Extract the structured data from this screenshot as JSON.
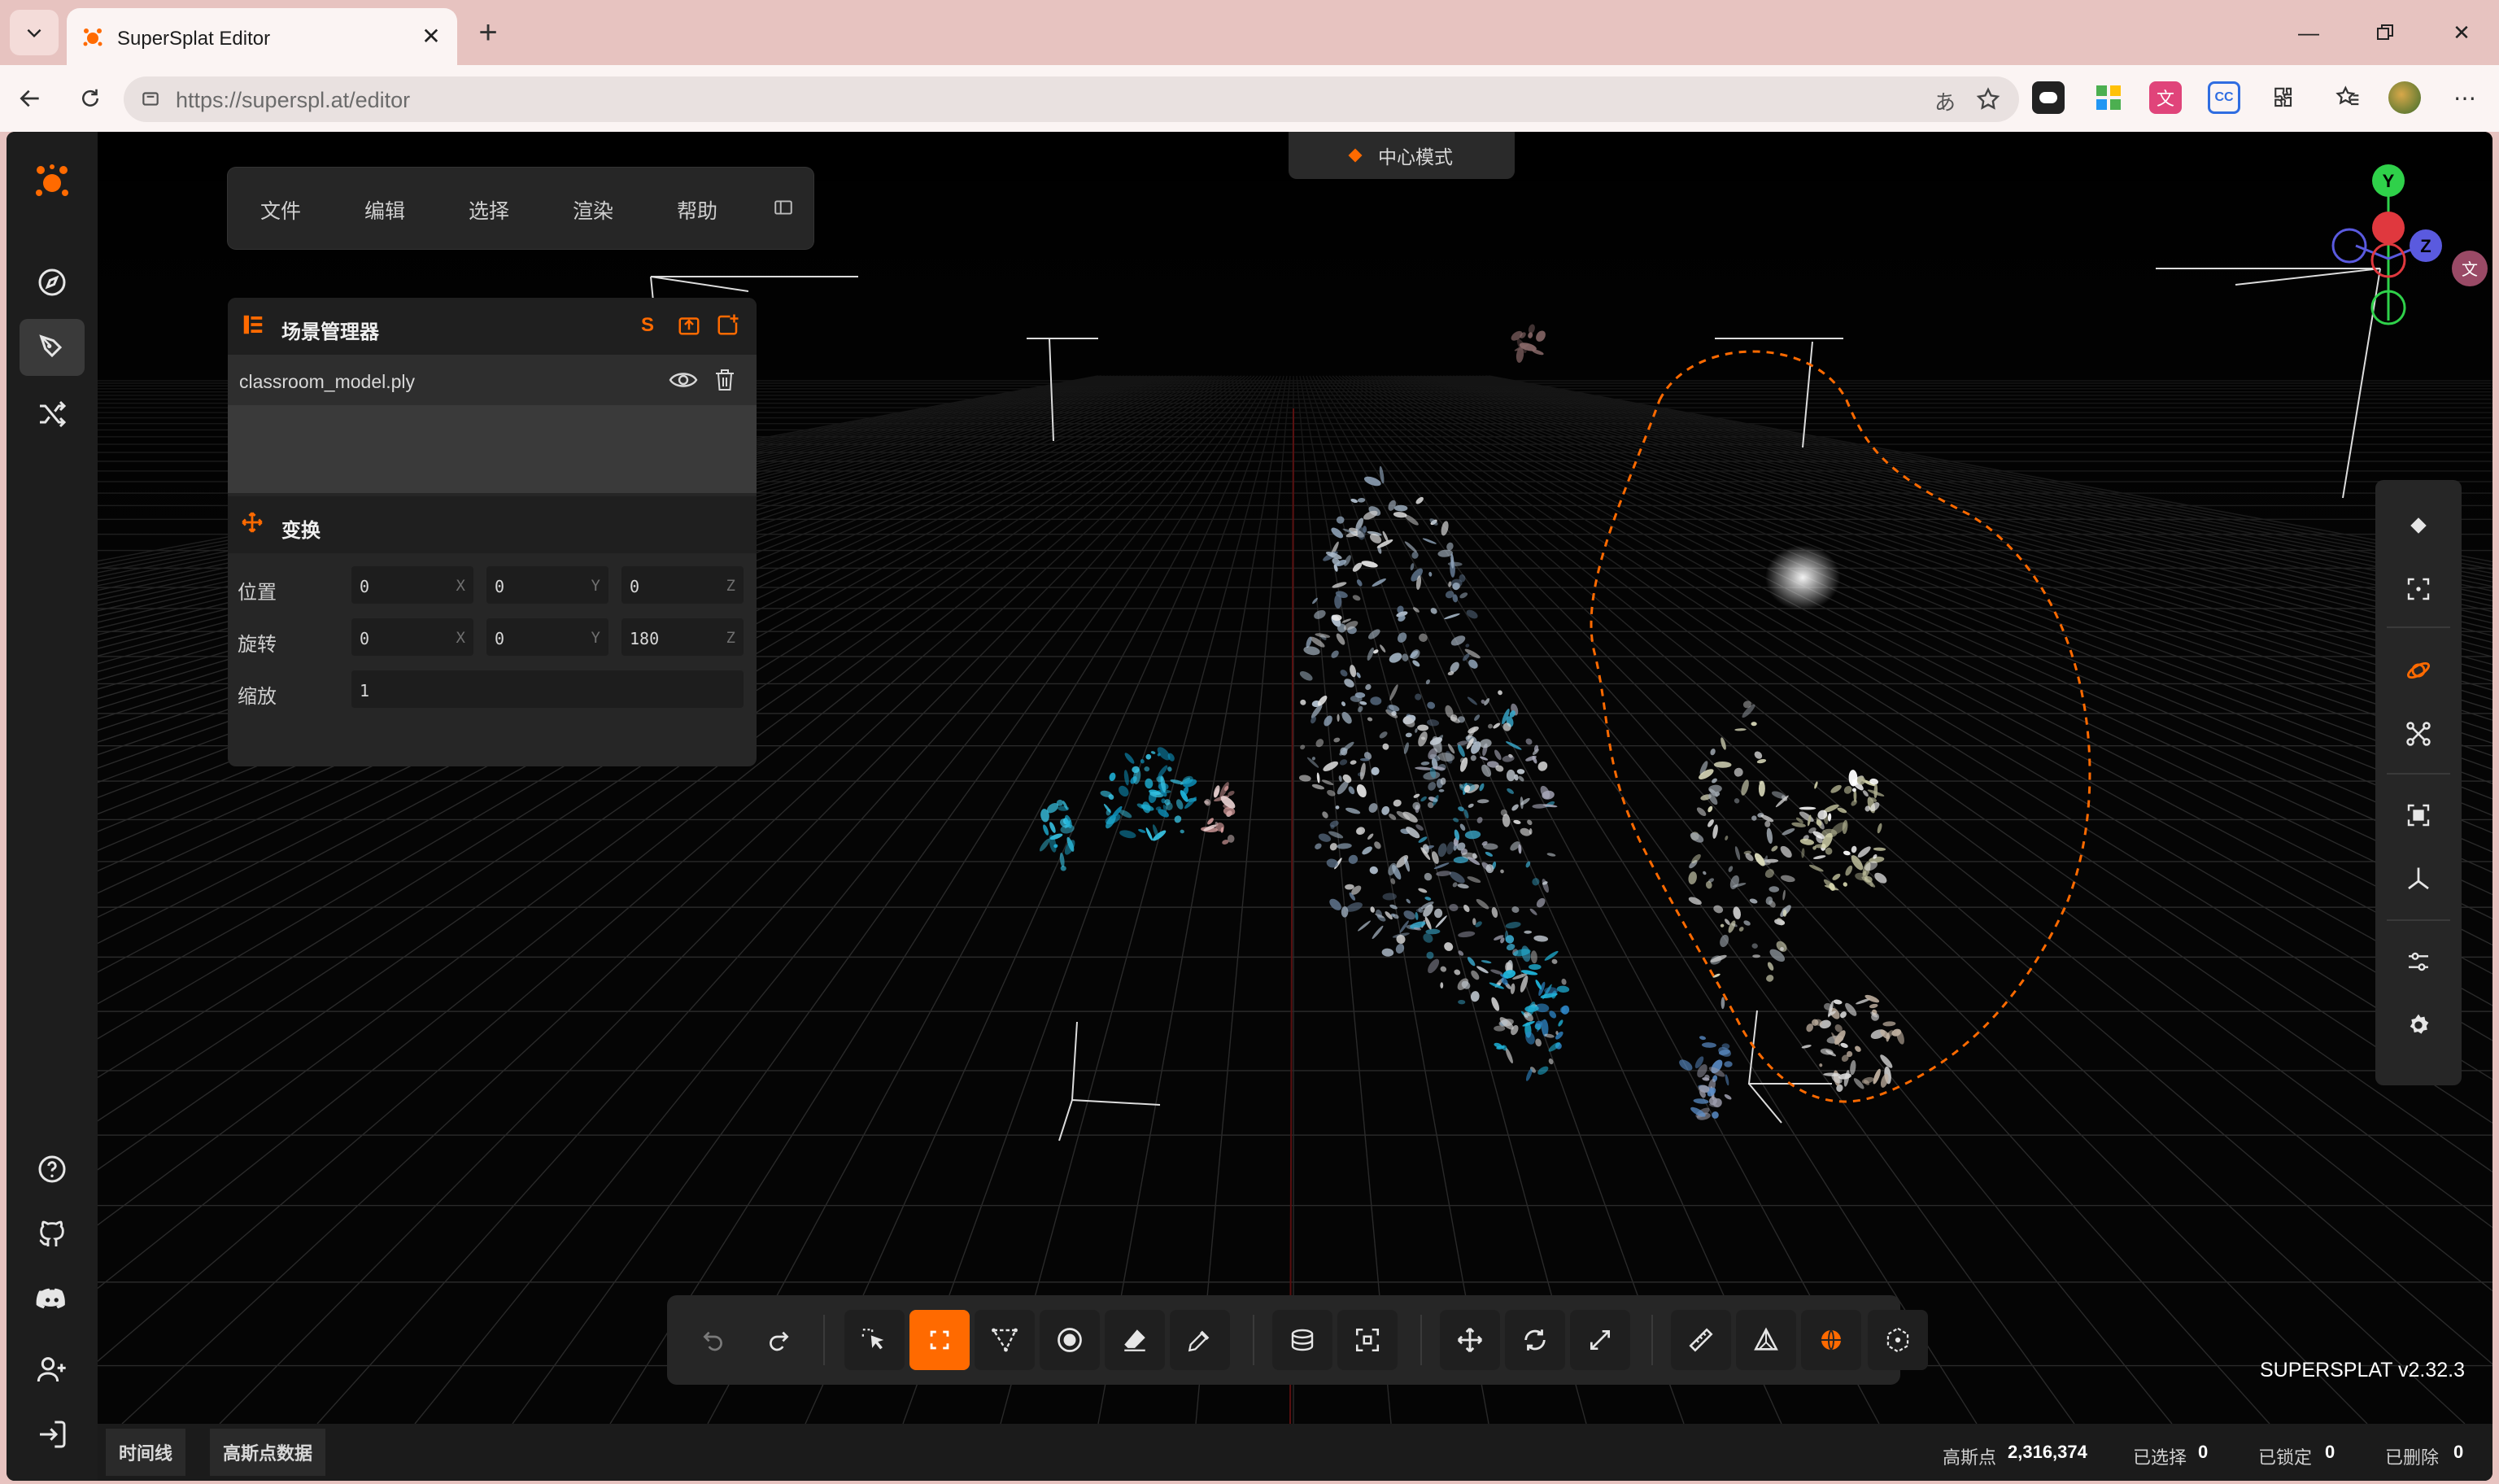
{
  "browser": {
    "tab_title": "SuperSplat Editor",
    "url_host": "https://superspl.at",
    "url_path": "/editor"
  },
  "menu": {
    "file": "文件",
    "edit": "编辑",
    "select": "选择",
    "render": "渲染",
    "help": "帮助"
  },
  "mode_pill": {
    "label": "中心模式"
  },
  "scene_manager": {
    "title": "场景管理器",
    "file_name": "classroom_model.ply"
  },
  "transform": {
    "title": "变换",
    "position_label": "位置",
    "rotation_label": "旋转",
    "scale_label": "缩放",
    "position": {
      "x": "0",
      "y": "0",
      "z": "0"
    },
    "rotation": {
      "x": "0",
      "y": "0",
      "z": "180"
    },
    "scale": "1",
    "axis": {
      "x": "X",
      "y": "Y",
      "z": "Z"
    }
  },
  "gizmo": {
    "y": "Y",
    "z": "Z"
  },
  "version": "SUPERSPLAT v2.32.3",
  "statusbar": {
    "timeline_tab": "时间线",
    "splat_data_tab": "高斯点数据",
    "splats_label": "高斯点",
    "splats_value": "2,316,374",
    "selected_label": "已选择",
    "selected_value": "0",
    "locked_label": "已锁定",
    "locked_value": "0",
    "deleted_label": "已删除",
    "deleted_value": "0"
  },
  "colors": {
    "accent": "#ff6a00",
    "panel": "#262626",
    "viewport": "#050505"
  }
}
